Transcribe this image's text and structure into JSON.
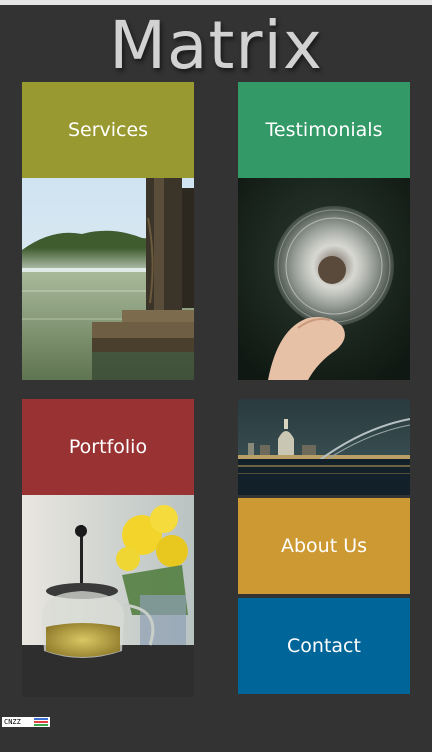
{
  "site": {
    "title": "Matrix"
  },
  "tiles": {
    "services": {
      "label": "Services",
      "color": "#999931"
    },
    "testimonials": {
      "label": "Testimonials",
      "color": "#339966"
    },
    "portfolio": {
      "label": "Portfolio",
      "color": "#993333"
    },
    "about": {
      "label": "About Us",
      "color": "#cc9933"
    },
    "contact": {
      "label": "Contact",
      "color": "#006699"
    }
  },
  "counter": {
    "label": "CNZZ"
  }
}
